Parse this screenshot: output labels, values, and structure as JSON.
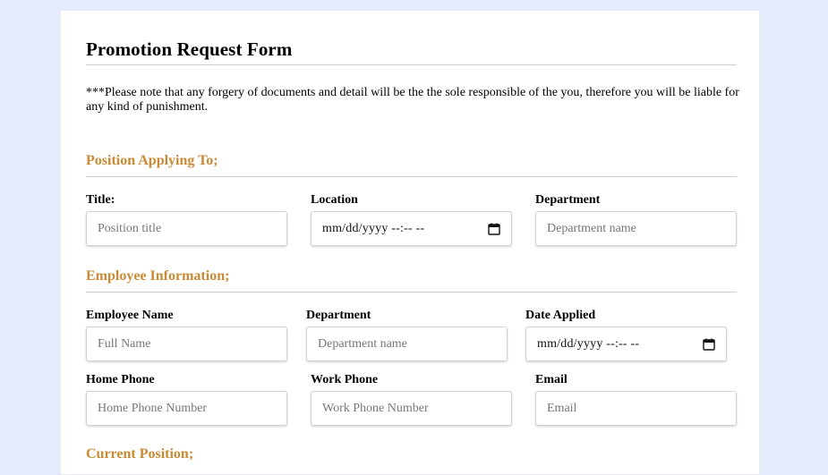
{
  "form": {
    "title": "Promotion Request Form",
    "note": "***Please note that any forgery of documents and detail will be the the sole responsible of the you, therefore you will be liable for any kind of punishment."
  },
  "position_section": {
    "heading": "Position Applying To;",
    "title_label": "Title:",
    "title_placeholder": "Position title",
    "location_label": "Location",
    "location_value": "mm/dd/yyyy --:-- --",
    "department_label": "Department",
    "department_placeholder": "Department name"
  },
  "employee_section": {
    "heading": "Employee Information;",
    "name_label": "Employee Name",
    "name_placeholder": "Full Name",
    "department_label": "Department",
    "department_placeholder": "Department name",
    "date_applied_label": "Date Applied",
    "date_applied_value": "mm/dd/yyyy --:-- --",
    "home_phone_label": "Home Phone",
    "home_phone_placeholder": "Home Phone Number",
    "work_phone_label": "Work Phone",
    "work_phone_placeholder": "Work Phone Number",
    "email_label": "Email",
    "email_placeholder": "Email"
  },
  "current_section": {
    "heading": "Current Position;"
  },
  "colors": {
    "background": "#e3ebfc",
    "accent": "#c98a34",
    "card": "#ffffff"
  },
  "icons": {
    "date_picker": "calendar-icon"
  }
}
